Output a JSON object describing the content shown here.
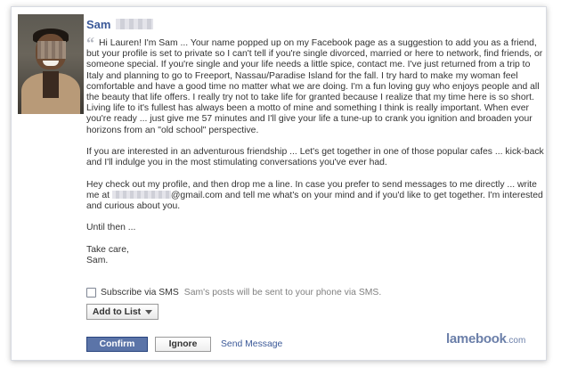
{
  "profile": {
    "name": "Sam"
  },
  "message": {
    "paragraphs": [
      "Hi Lauren! I'm Sam ... Your name popped up on my Facebook page as a suggestion to add you as a friend, but your profile is set to private so I can't tell if you're single divorced, married or here to network, find friends, or someone special. If you're single and your life needs a little spice, contact me. I've just returned from a trip to Italy and planning to go to Freeport, Nassau/Paradise Island for the fall. I try hard to make my woman feel comfortable and have a good time no matter what we are doing. I'm a fun loving guy who enjoys people and all the beauty that life offers. I really try not to take life for granted because I realize that my time here is so short. Living life to it's fullest has always been a motto of mine and something I think is really important. When ever you're ready ... just give me 57 minutes and I'll give your life a tune-up to crank you ignition and broaden your horizons from an \"old school\" perspective.",
      "If you are interested in an adventurous friendship ... Let's get together in one of those popular cafes ... kick-back and I'll indulge you in the most stimulating conversations you've ever had.",
      "Until then ...",
      "Take care,",
      "Sam."
    ],
    "contact_before": "Hey check out my profile, and then drop me a line. In case you prefer to send messages to me directly ... write me at ",
    "contact_after": "@gmail.com and tell me what's on your mind and if you'd like to get together. I'm interested and curious about you."
  },
  "sms": {
    "label": "Subscribe via SMS",
    "note": "Sam's posts will be sent to your phone via SMS."
  },
  "add_to_list": {
    "label": "Add to List"
  },
  "actions": {
    "confirm": "Confirm",
    "ignore": "Ignore",
    "send_message": "Send Message"
  },
  "brand": {
    "name": "lamebook",
    "domain": ".com"
  },
  "colors": {
    "link": "#3b5998",
    "confirm_bg": "#5b74a8",
    "text": "#333333",
    "muted": "#808080"
  },
  "icons": {
    "quote": "quote-mark-icon",
    "dropdown": "chevron-down-icon"
  }
}
